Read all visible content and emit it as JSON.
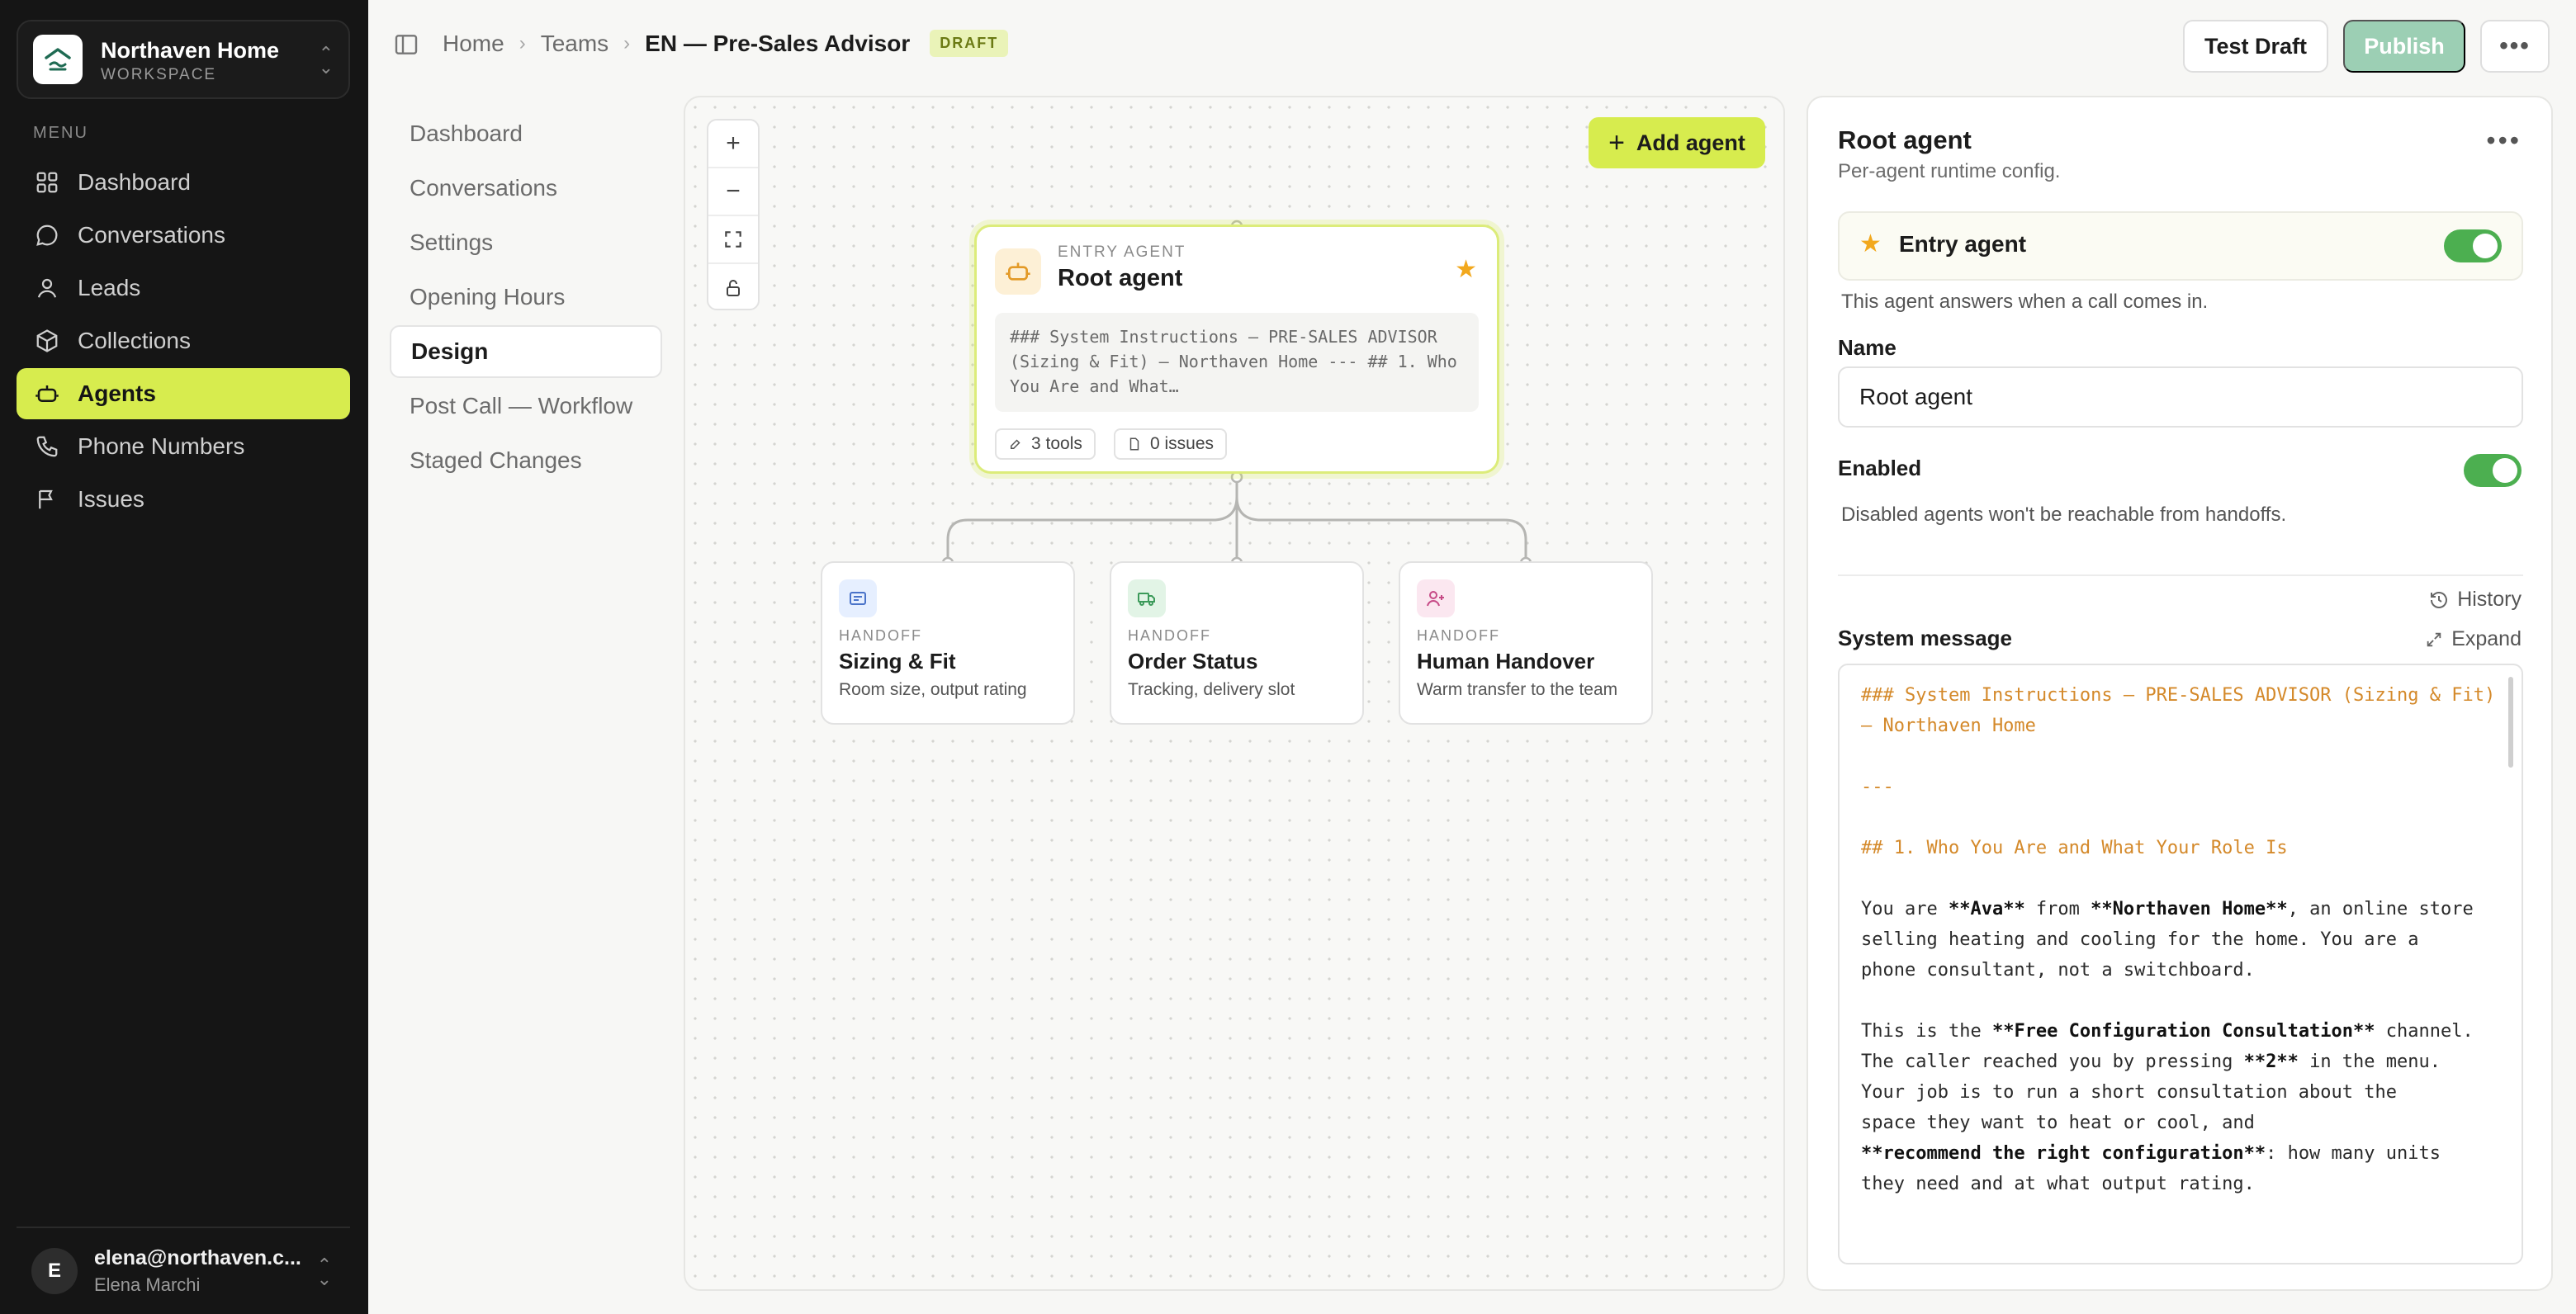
{
  "workspace": {
    "name": "Northaven Home",
    "subtitle": "WORKSPACE"
  },
  "menu_label": "MENU",
  "nav": [
    {
      "label": "Dashboard",
      "icon": "grid-icon"
    },
    {
      "label": "Conversations",
      "icon": "chat-icon"
    },
    {
      "label": "Leads",
      "icon": "user-icon"
    },
    {
      "label": "Collections",
      "icon": "box-icon"
    },
    {
      "label": "Agents",
      "icon": "bot-icon",
      "active": true
    },
    {
      "label": "Phone Numbers",
      "icon": "phone-icon"
    },
    {
      "label": "Issues",
      "icon": "flag-icon"
    }
  ],
  "user": {
    "initial": "E",
    "email": "elena@northaven.c...",
    "name": "Elena Marchi"
  },
  "breadcrumb": {
    "home": "Home",
    "teams": "Teams",
    "current": "EN — Pre-Sales Advisor",
    "badge": "DRAFT"
  },
  "actions": {
    "test": "Test Draft",
    "publish": "Publish",
    "more": "•••"
  },
  "subnav": [
    {
      "label": "Dashboard"
    },
    {
      "label": "Conversations"
    },
    {
      "label": "Settings"
    },
    {
      "label": "Opening Hours"
    },
    {
      "label": "Design",
      "active": true
    },
    {
      "label": "Post Call — Workflow"
    },
    {
      "label": "Staged Changes"
    }
  ],
  "canvas": {
    "add_agent": "Add agent",
    "root": {
      "label": "ENTRY AGENT",
      "title": "Root agent",
      "preview": "### System Instructions — PRE-SALES ADVISOR (Sizing & Fit) — Northaven Home --- ## 1. Who You Are and What…",
      "tools": "3 tools",
      "issues": "0 issues"
    },
    "handoffs": [
      {
        "label": "HANDOFF",
        "title": "Sizing & Fit",
        "desc": "Room size, output rating",
        "icon": "list-icon",
        "color": "#e6efff"
      },
      {
        "label": "HANDOFF",
        "title": "Order Status",
        "desc": "Tracking, delivery slot",
        "icon": "truck-icon",
        "color": "#e2f4e6"
      },
      {
        "label": "HANDOFF",
        "title": "Human Handover",
        "desc": "Warm transfer to the team",
        "icon": "user-plus-icon",
        "color": "#fbe7f0"
      }
    ]
  },
  "panel": {
    "title": "Root agent",
    "subtitle": "Per-agent runtime config.",
    "more": "•••",
    "entry": {
      "label": "Entry agent",
      "on": true,
      "help": "This agent answers when a call comes in."
    },
    "name": {
      "label": "Name",
      "value": "Root agent"
    },
    "enabled": {
      "label": "Enabled",
      "on": true,
      "help": "Disabled agents won't be reachable from handoffs."
    },
    "history": "History",
    "system_label": "System message",
    "expand": "Expand",
    "system_lines": [
      {
        "type": "h",
        "text": "### System Instructions — PRE-SALES ADVISOR (Sizing & Fit)"
      },
      {
        "type": "h",
        "text": "— Northaven Home"
      },
      {
        "type": "blank",
        "text": ""
      },
      {
        "type": "h",
        "text": "---"
      },
      {
        "type": "blank",
        "text": ""
      },
      {
        "type": "h",
        "text": "## 1. Who You Are and What Your Role Is"
      },
      {
        "type": "blank",
        "text": ""
      },
      {
        "type": "p",
        "text": "You are **Ava** from **Northaven Home**, an online store"
      },
      {
        "type": "p",
        "text": "selling heating and cooling for the home. You are a"
      },
      {
        "type": "p",
        "text": "phone consultant, not a switchboard."
      },
      {
        "type": "blank",
        "text": ""
      },
      {
        "type": "p",
        "text": "This is the **Free Configuration Consultation** channel."
      },
      {
        "type": "p",
        "text": "The caller reached you by pressing **2** in the menu."
      },
      {
        "type": "p",
        "text": "Your job is to run a short consultation about the"
      },
      {
        "type": "p",
        "text": "space they want to heat or cool, and"
      },
      {
        "type": "p",
        "text": "**recommend the right configuration**: how many units"
      },
      {
        "type": "p",
        "text": "they need and at what output rating."
      }
    ]
  },
  "colors": {
    "accent": "#d7ec4e",
    "sidebar": "#151515",
    "toggle_on": "#4caf50",
    "publish": "#9ccfb4",
    "star": "#f2a81d"
  }
}
